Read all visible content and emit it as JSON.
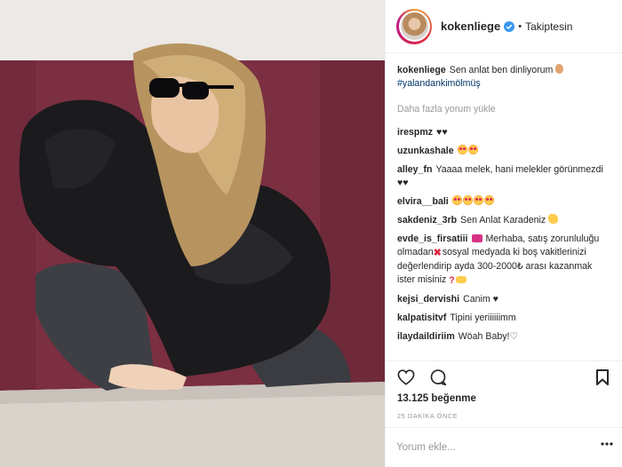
{
  "post": {
    "username": "kokenliege",
    "follow_status": "Takiptesin",
    "dot": "•",
    "likes": "13.125 beğenme",
    "time": "25 DAKİKA ÖNCE",
    "load_more": "Daha fazla yorum yükle",
    "comment_placeholder": "Yorum ekle..."
  },
  "caption": {
    "user": "kokenliege",
    "text": "Sen anlat ben dinliyorum",
    "hashtag": "#yalandankimölmüş"
  },
  "comments": [
    {
      "user": "irespmz",
      "text": "♥♥"
    },
    {
      "user": "uzunkashale",
      "text": ""
    },
    {
      "user": "alley_fn",
      "text": "Yaaaa melek, hani melekler görünmezdi ♥♥"
    },
    {
      "user": "elvira__bali",
      "text": ""
    },
    {
      "user": "sakdeniz_3rb",
      "text": "Sen Anlat Karadeniz"
    },
    {
      "user": "evde_is_firsatiii",
      "text_a": "Merhaba, satış zorunluluğu olmadan",
      "text_b": "sosyal medyada ki boş vakitlerinizi değerlendirip ayda 300-2000₺ arası kazanmak ister misiniz"
    },
    {
      "user": "kejsi_dervishi",
      "text": "Canim ♥"
    },
    {
      "user": "kalpatisitvf",
      "text": "Tipini yeriiiiiimm"
    },
    {
      "user": "ilaydaildiriim",
      "text": "Wöah Baby!♡"
    }
  ],
  "icons": [
    "verified-icon",
    "heart-icon",
    "comment-icon",
    "bookmark-icon",
    "more-icon"
  ],
  "colors": {
    "verified": "#3897f0",
    "wall": "#7a2f3e",
    "link": "#003569"
  }
}
